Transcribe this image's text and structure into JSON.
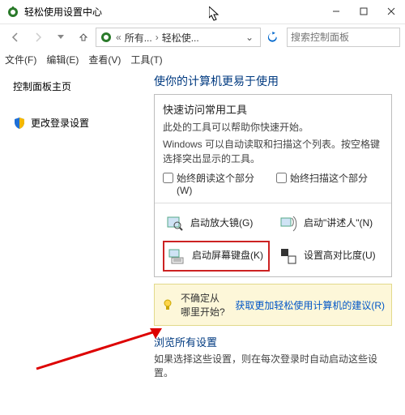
{
  "window": {
    "title": "轻松使用设置中心"
  },
  "nav": {
    "crumb1": "所有...",
    "crumb2": "轻松使...",
    "search_placeholder": "搜索控制面板"
  },
  "menu": {
    "file": "文件(F)",
    "edit": "编辑(E)",
    "view": "查看(V)",
    "tools": "工具(T)"
  },
  "sidebar": {
    "home": "控制面板主页",
    "login": "更改登录设置"
  },
  "main": {
    "heading": "使你的计算机更易于使用",
    "box": {
      "title": "快速访问常用工具",
      "sub": "此处的工具可以帮助你快速开始。",
      "desc": "Windows 可以自动读取和扫描这个列表。按空格键选择突出显示的工具。",
      "cb1": "始终朗读这个部分(W)",
      "cb2": "始终扫描这个部分"
    },
    "tiles": {
      "magnifier": "启动放大镜(G)",
      "narrator": "启动\"讲述人\"(N)",
      "osk": "启动屏幕键盘(K)",
      "contrast": "设置高对比度(U)"
    },
    "hint": {
      "text": "不确定从哪里开始?",
      "link": "获取更加轻松使用计算机的建议(R)"
    },
    "browse": {
      "heading": "浏览所有设置",
      "desc": "如果选择这些设置，则在每次登录时自动启动这些设置。"
    }
  }
}
